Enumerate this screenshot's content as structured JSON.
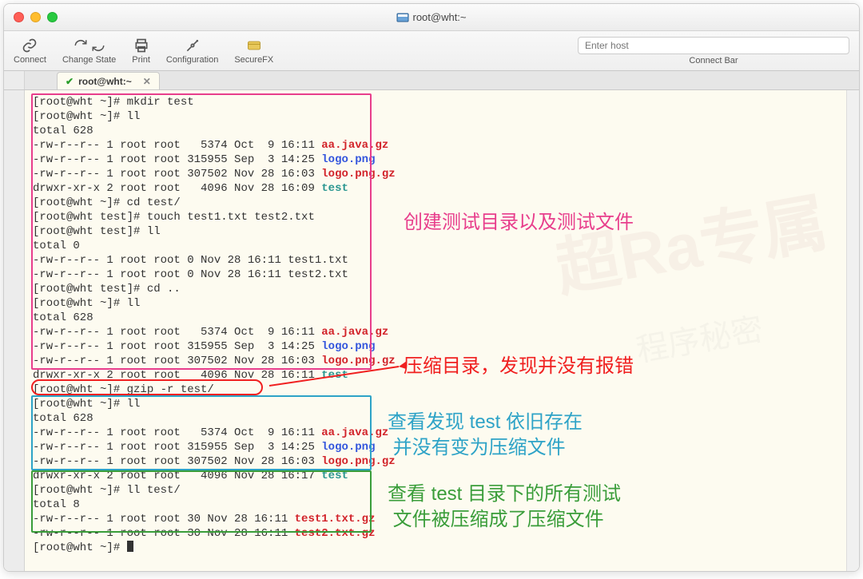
{
  "window": {
    "title": "root@wht:~"
  },
  "toolbar": {
    "connect": "Connect",
    "change_state": "Change State",
    "print": "Print",
    "configuration": "Configuration",
    "securefx": "SecureFX",
    "host_placeholder": "Enter host",
    "connect_bar": "Connect Bar"
  },
  "tab": {
    "label": "root@wht:~"
  },
  "term": {
    "lines": [
      {
        "t": "[root@wht ~]# mkdir test"
      },
      {
        "t": "[root@wht ~]# ll"
      },
      {
        "t": "total 628"
      },
      {
        "t": "-rw-r--r-- 1 root root   5374 Oct  9 16:11 ",
        "s": "aa.java.gz",
        "sc": "red"
      },
      {
        "t": "-rw-r--r-- 1 root root 315955 Sep  3 14:25 ",
        "s": "logo.png",
        "sc": "blue"
      },
      {
        "t": "-rw-r--r-- 1 root root 307502 Nov 28 16:03 ",
        "s": "logo.png.gz",
        "sc": "red"
      },
      {
        "t": "drwxr-xr-x 2 root root   4096 Nov 28 16:09 ",
        "s": "test",
        "sc": "teal"
      },
      {
        "t": "[root@wht ~]# cd test/"
      },
      {
        "t": "[root@wht test]# touch test1.txt test2.txt"
      },
      {
        "t": "[root@wht test]# ll"
      },
      {
        "t": "total 0"
      },
      {
        "t": "-rw-r--r-- 1 root root 0 Nov 28 16:11 test1.txt"
      },
      {
        "t": "-rw-r--r-- 1 root root 0 Nov 28 16:11 test2.txt"
      },
      {
        "t": "[root@wht test]# cd .."
      },
      {
        "t": "[root@wht ~]# ll"
      },
      {
        "t": "total 628"
      },
      {
        "t": "-rw-r--r-- 1 root root   5374 Oct  9 16:11 ",
        "s": "aa.java.gz",
        "sc": "red"
      },
      {
        "t": "-rw-r--r-- 1 root root 315955 Sep  3 14:25 ",
        "s": "logo.png",
        "sc": "blue"
      },
      {
        "t": "-rw-r--r-- 1 root root 307502 Nov 28 16:03 ",
        "s": "logo.png.gz",
        "sc": "red"
      },
      {
        "t": "drwxr-xr-x 2 root root   4096 Nov 28 16:11 ",
        "s": "test",
        "sc": "teal"
      },
      {
        "t": "[root@wht ~]# gzip -r test/"
      },
      {
        "t": "[root@wht ~]# ll"
      },
      {
        "t": "total 628"
      },
      {
        "t": "-rw-r--r-- 1 root root   5374 Oct  9 16:11 ",
        "s": "aa.java.gz",
        "sc": "red"
      },
      {
        "t": "-rw-r--r-- 1 root root 315955 Sep  3 14:25 ",
        "s": "logo.png",
        "sc": "blue"
      },
      {
        "t": "-rw-r--r-- 1 root root 307502 Nov 28 16:03 ",
        "s": "logo.png.gz",
        "sc": "red"
      },
      {
        "t": "drwxr-xr-x 2 root root   4096 Nov 28 16:17 ",
        "s": "test",
        "sc": "teal"
      },
      {
        "t": "[root@wht ~]# ll test/"
      },
      {
        "t": "total 8"
      },
      {
        "t": "-rw-r--r-- 1 root root 30 Nov 28 16:11 ",
        "s": "test1.txt.gz",
        "sc": "red"
      },
      {
        "t": "-rw-r--r-- 1 root root 30 Nov 28 16:11 ",
        "s": "test2.txt.gz",
        "sc": "red"
      },
      {
        "t": "[root@wht ~]# ",
        "cursor": true
      }
    ]
  },
  "annotations": {
    "pink": "创建测试目录以及测试文件",
    "red": "压缩目录，发现并没有报错",
    "cyan": "查看发现 test 依旧存在\n 并没有变为压缩文件",
    "green": "查看 test 目录下的所有测试\n 文件被压缩成了压缩文件"
  }
}
